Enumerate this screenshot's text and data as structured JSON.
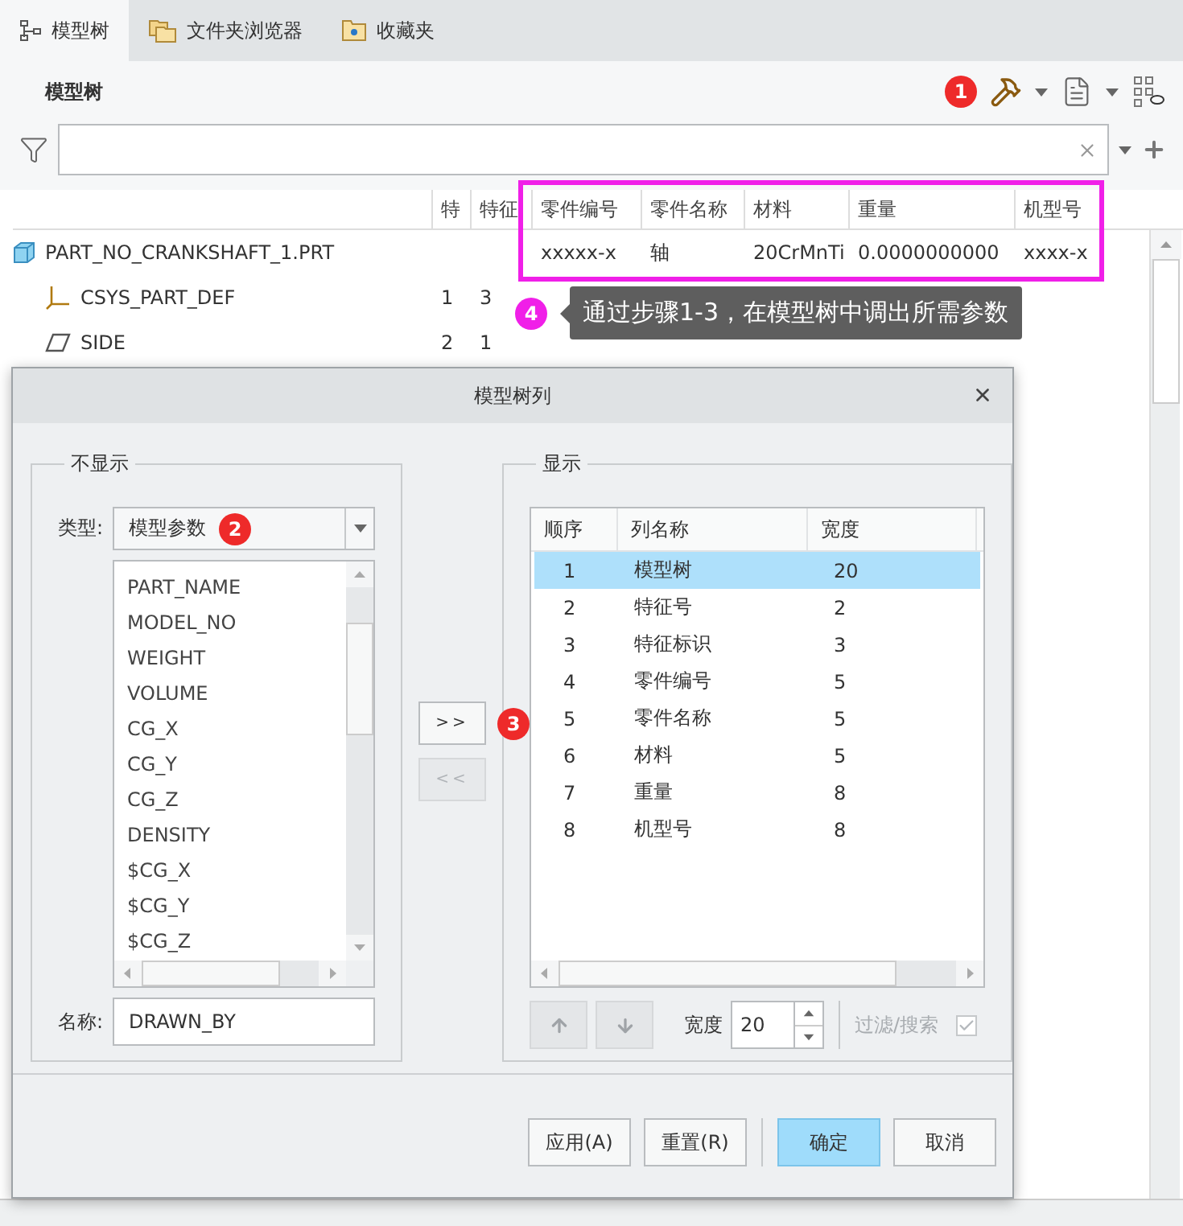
{
  "tabs": [
    {
      "label": "模型树",
      "kind": "tree",
      "selected": true
    },
    {
      "label": "文件夹浏览器",
      "kind": "folders",
      "selected": false
    },
    {
      "label": "收藏夹",
      "kind": "favorites",
      "selected": false
    }
  ],
  "panel": {
    "title": "模型树",
    "badge": "1"
  },
  "tree": {
    "columns": [
      "特",
      "特征",
      "零件编号",
      "零件名称",
      "材料",
      "重量",
      "机型号"
    ],
    "rows": [
      {
        "name": "PART_NO_CRANKSHAFT_1.PRT",
        "kind": "part",
        "cells": [
          null,
          null,
          "xxxxx-x",
          "轴",
          "20CrMnTi",
          "0.0000000000",
          "xxxx-x"
        ],
        "children": [
          {
            "name": "CSYS_PART_DEF",
            "kind": "csys",
            "cells": [
              "1",
              "3"
            ]
          },
          {
            "name": "SIDE",
            "kind": "plane",
            "cells": [
              "2",
              "1"
            ]
          }
        ]
      }
    ]
  },
  "callout": {
    "badge": "4",
    "text": "通过步骤1-3，在模型树中调出所需参数"
  },
  "dialog": {
    "title": "模型树列",
    "hidden": {
      "legend": "不显示",
      "type_label": "类型:",
      "type_value": "模型参数",
      "type_badge": "2",
      "items": [
        "PART_NAME",
        "MODEL_NO",
        "WEIGHT",
        "VOLUME",
        "CG_X",
        "CG_Y",
        "CG_Z",
        "DENSITY",
        "$CG_X",
        "$CG_Y",
        "$CG_Z"
      ],
      "name_label": "名称:",
      "name_value": "DRAWN_BY"
    },
    "add_button": {
      "label": ">>",
      "disabled": false,
      "badge": "3"
    },
    "remove_button": {
      "label": "<<",
      "disabled": true
    },
    "shown": {
      "legend": "显示",
      "columns": [
        "顺序",
        "列名称",
        "宽度"
      ],
      "rows": [
        {
          "cells": [
            "1",
            "模型树",
            "20"
          ],
          "selected": true
        },
        {
          "cells": [
            "2",
            "特征号",
            "2"
          ],
          "selected": false
        },
        {
          "cells": [
            "3",
            "特征标识",
            "3"
          ],
          "selected": false
        },
        {
          "cells": [
            "4",
            "零件编号",
            "5"
          ],
          "selected": false
        },
        {
          "cells": [
            "5",
            "零件名称",
            "5"
          ],
          "selected": false
        },
        {
          "cells": [
            "6",
            "材料",
            "5"
          ],
          "selected": false
        },
        {
          "cells": [
            "7",
            "重量",
            "8"
          ],
          "selected": false
        },
        {
          "cells": [
            "8",
            "机型号",
            "8"
          ],
          "selected": false
        }
      ],
      "move_up_disabled": true,
      "move_down_disabled": true,
      "width_label": "宽度",
      "width_value": "20",
      "filter_label": "过滤/搜索",
      "filter_checked": true,
      "filter_disabled": true
    },
    "buttons": [
      {
        "label": "应用(A)",
        "primary": false
      },
      {
        "label": "重置(R)",
        "primary": false
      },
      {
        "label": "确定",
        "primary": true
      },
      {
        "label": "取消",
        "primary": false
      }
    ]
  }
}
